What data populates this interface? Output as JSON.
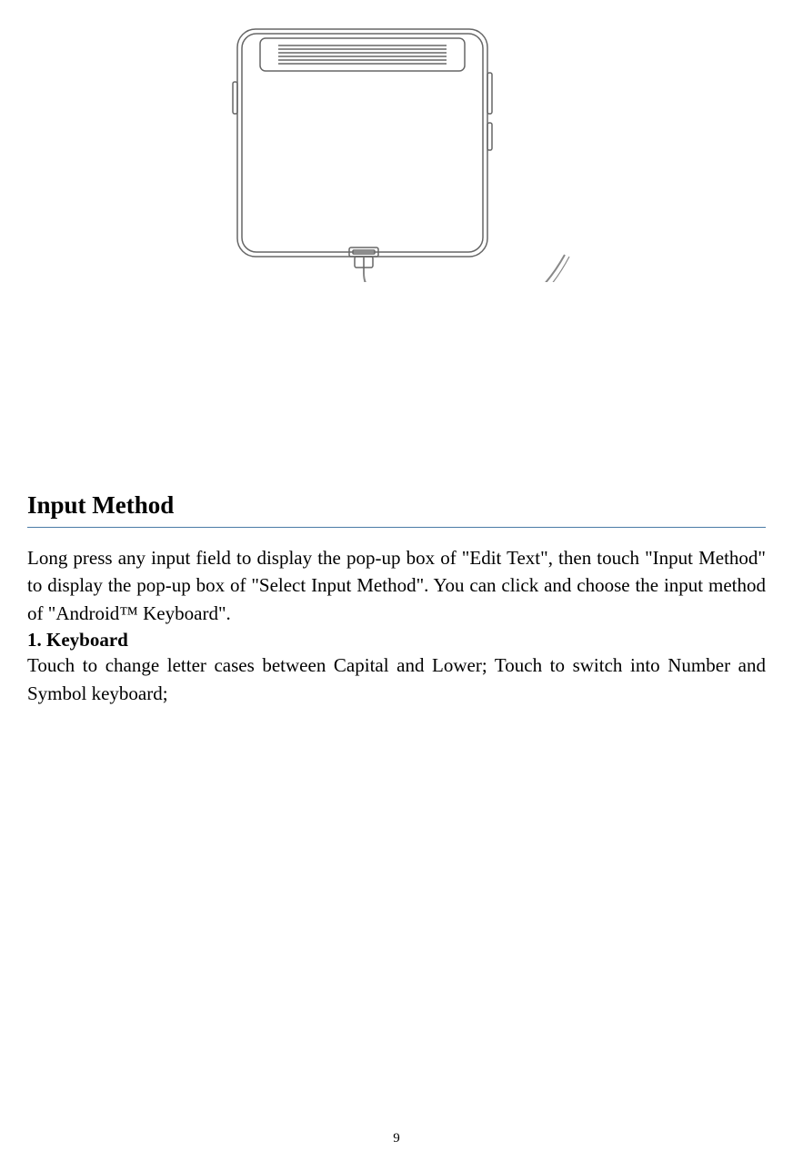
{
  "section": {
    "title": "Input Method",
    "paragraph1": "Long press any input field to display the pop-up box of \"Edit Text\", then touch \"Input Method\" to display the pop-up box of \"Select Input Method\". You can click and choose the input method of \"Android™ Keyboard\".",
    "list": {
      "item1_heading": "1.   Keyboard",
      "item1_body": "Touch   to change letter cases between Capital and Lower; Touch   to switch into Number and Symbol keyboard;"
    }
  },
  "page_number": "9"
}
